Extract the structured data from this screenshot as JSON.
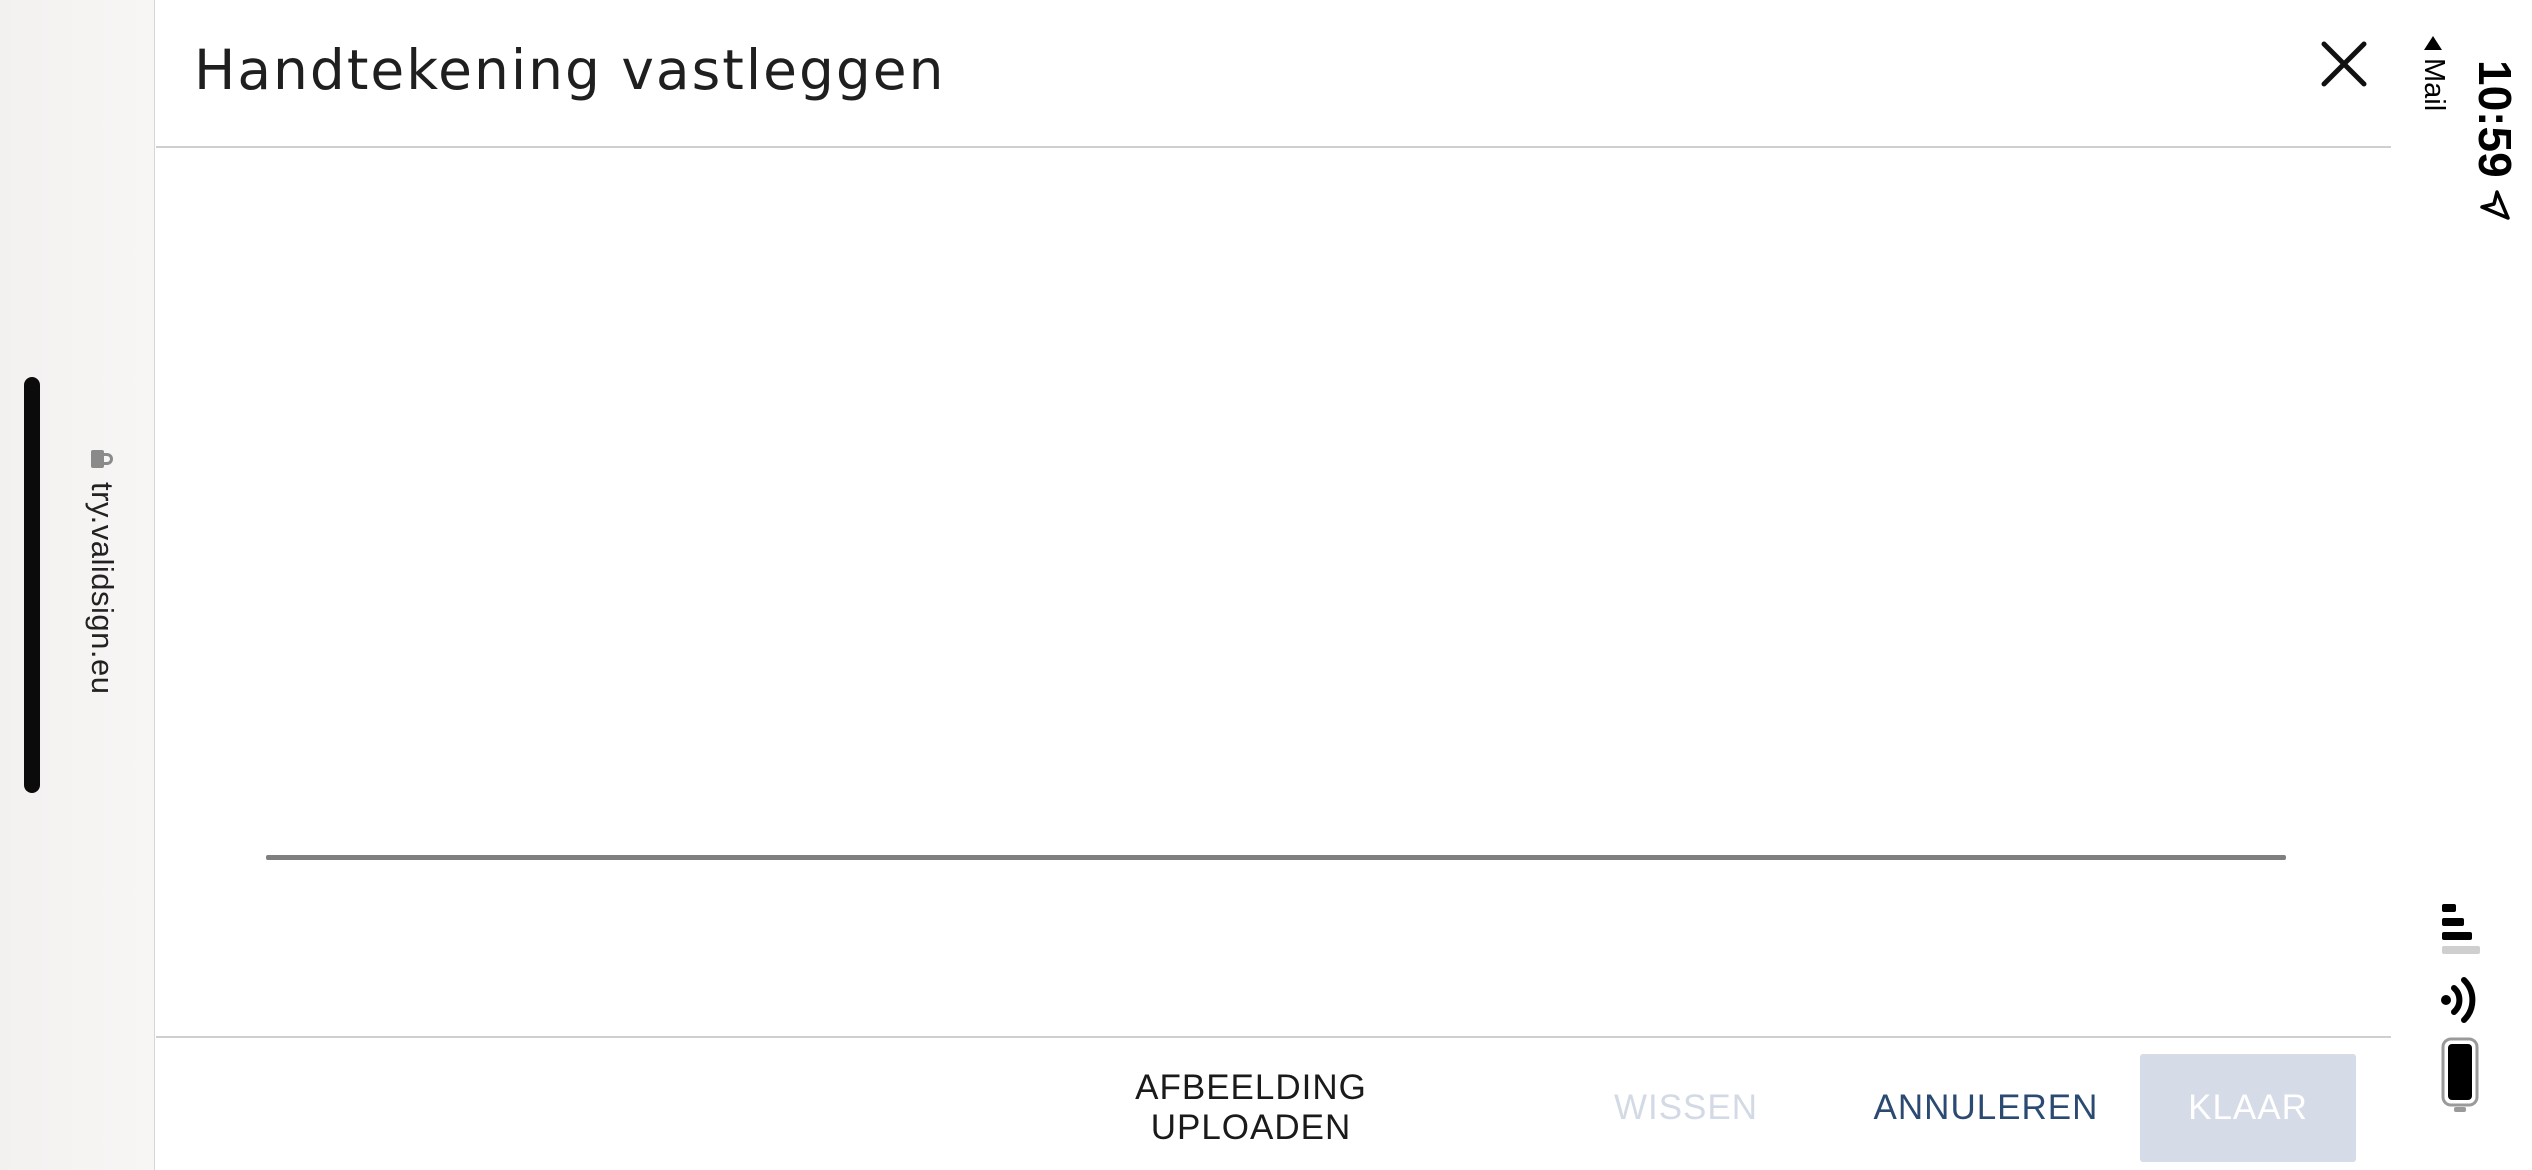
{
  "browser": {
    "url": "try.validsign.eu",
    "lock_icon": "lock-icon"
  },
  "status_bar": {
    "time": "10:59",
    "back_app": "Mail",
    "location_icon": "location-arrow-icon",
    "signal_icon": "cellular-signal-icon",
    "wifi_icon": "wifi-icon",
    "battery_icon": "battery-icon"
  },
  "dialog": {
    "title": "Handtekening vastleggen",
    "close_icon": "close-icon",
    "buttons": {
      "upload": "AFBEELDING UPLOADEN",
      "clear": "WISSEN",
      "cancel": "ANNULEREN",
      "done": "KLAAR"
    }
  },
  "colors": {
    "cancel_text": "#2b4a72",
    "disabled_text": "#d3dae6",
    "done_bg": "#d5dce7",
    "signature_line": "#7f7f7f"
  }
}
